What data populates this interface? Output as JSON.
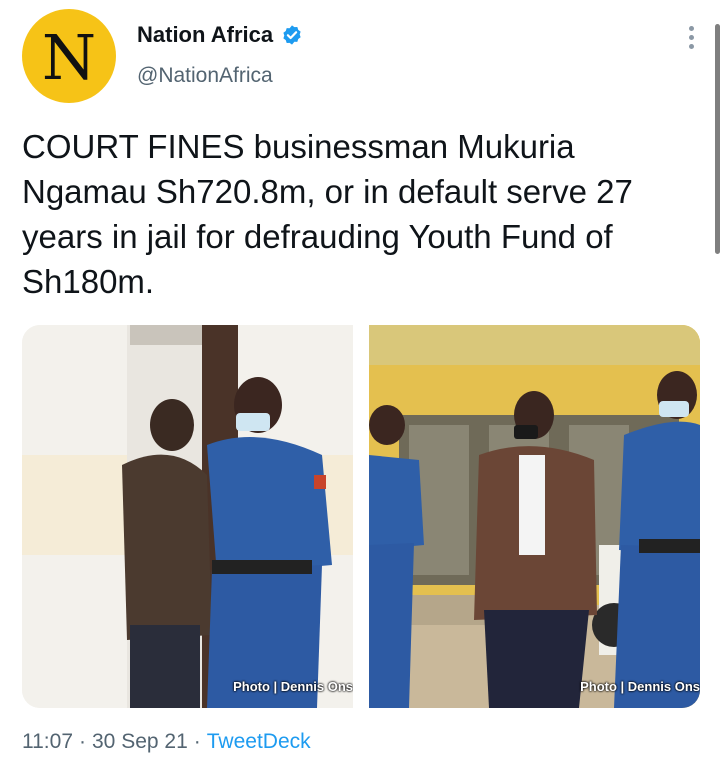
{
  "account": {
    "avatar_letter": "N",
    "avatar_bg": "#f6c317",
    "display_name": "Nation Africa",
    "verified_icon": "verified-badge-icon",
    "verified_color": "#1d9bf0",
    "handle": "@NationAfrica"
  },
  "tweet": {
    "text": "COURT FINES businessman Mukuria\nNgamau Sh720.8m, or in default serve 27\nyears in jail for defrauding Youth Fund of\nSh180m."
  },
  "media": [
    {
      "credit": "Photo | Dennis Ons"
    },
    {
      "credit": "Photo | Dennis Ons"
    }
  ],
  "meta": {
    "time": "11:07",
    "separator": "·",
    "date": "30 Sep 21",
    "source": "TweetDeck"
  }
}
